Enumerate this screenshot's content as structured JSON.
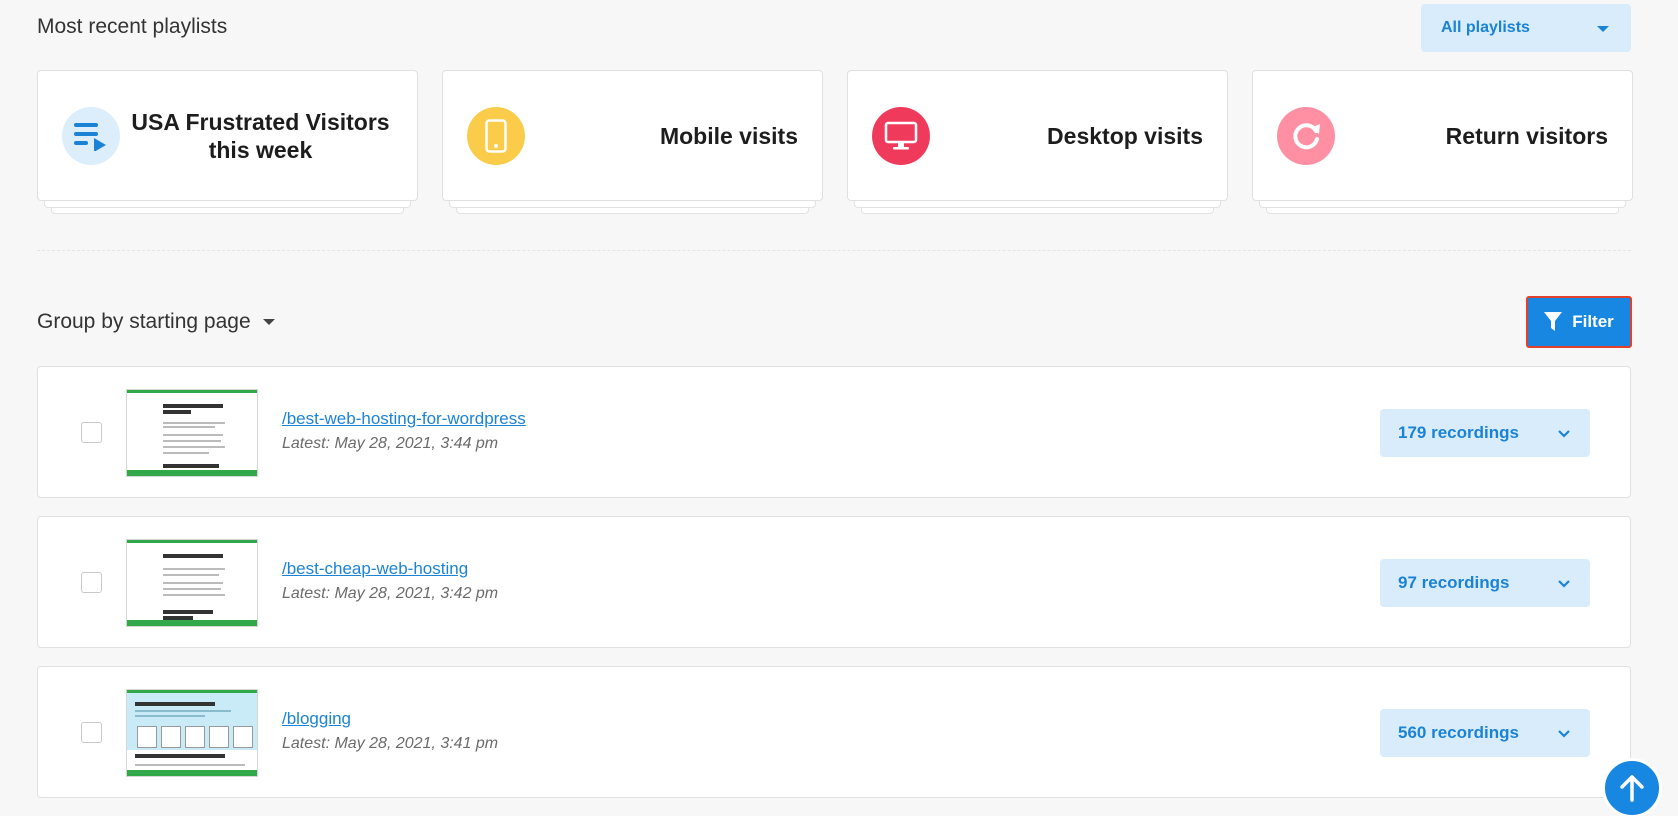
{
  "header": {
    "title": "Most recent playlists",
    "playlist_select": "All playlists"
  },
  "playlists": [
    {
      "label": "USA Frustrated Visitors this week",
      "icon": "playlist-icon",
      "color": "#dcedfb"
    },
    {
      "label": "Mobile visits",
      "icon": "mobile-icon",
      "color": "#fbcc4a"
    },
    {
      "label": "Desktop visits",
      "icon": "desktop-icon",
      "color": "#f03a5c"
    },
    {
      "label": "Return visitors",
      "icon": "refresh-icon",
      "color": "#ff8fa3"
    }
  ],
  "toolbar": {
    "group_by": "Group by starting page",
    "filter_label": "Filter"
  },
  "pages": [
    {
      "path": "/best-web-hosting-for-wordpress",
      "latest": "Latest: May 28, 2021, 3:44 pm",
      "recordings": "179 recordings"
    },
    {
      "path": "/best-cheap-web-hosting",
      "latest": "Latest: May 28, 2021, 3:42 pm",
      "recordings": "97 recordings"
    },
    {
      "path": "/blogging",
      "latest": "Latest: May 28, 2021, 3:41 pm",
      "recordings": "560 recordings"
    }
  ],
  "colors": {
    "accent": "#1787e2",
    "highlight_border": "#e0402c"
  }
}
